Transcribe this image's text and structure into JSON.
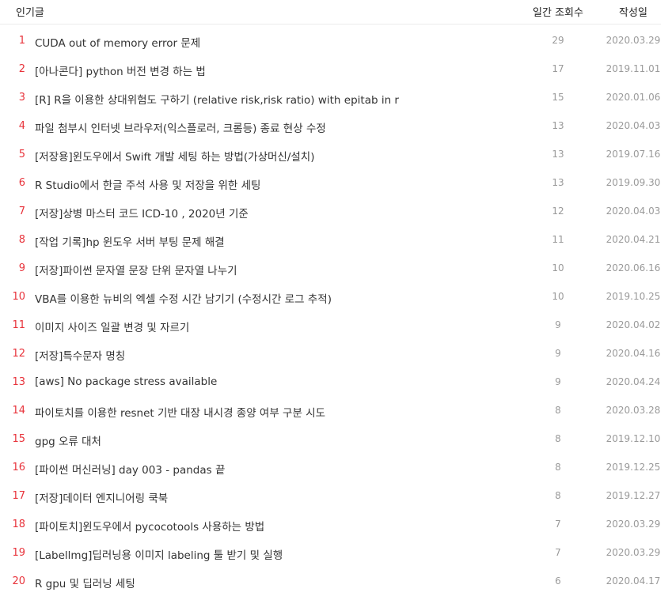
{
  "header": {
    "title": "인기글",
    "views": "일간 조회수",
    "date": "작성일"
  },
  "rows": [
    {
      "rank": "1",
      "title": "CUDA out of memory error 문제",
      "views": "29",
      "date": "2020.03.29"
    },
    {
      "rank": "2",
      "title": "[아나콘다] python 버전 변경 하는 법",
      "views": "17",
      "date": "2019.11.01"
    },
    {
      "rank": "3",
      "title": "[R] R을 이용한 상대위험도 구하기 (relative risk,risk ratio) with epitab in r",
      "views": "15",
      "date": "2020.01.06"
    },
    {
      "rank": "4",
      "title": "파일 첨부시 인터넷 브라우저(익스플로러, 크롬등) 종료 현상 수정",
      "views": "13",
      "date": "2020.04.03"
    },
    {
      "rank": "5",
      "title": "[저장용]윈도우에서 Swift 개발 세팅 하는 방법(가상머신/설치)",
      "views": "13",
      "date": "2019.07.16"
    },
    {
      "rank": "6",
      "title": "R Studio에서 한글 주석 사용 및 저장을 위한 세팅",
      "views": "13",
      "date": "2019.09.30"
    },
    {
      "rank": "7",
      "title": "[저장]상병 마스터 코드 ICD-10 , 2020년 기준",
      "views": "12",
      "date": "2020.04.03"
    },
    {
      "rank": "8",
      "title": "[작업 기록]hp 윈도우 서버 부팅 문제 해결",
      "views": "11",
      "date": "2020.04.21"
    },
    {
      "rank": "9",
      "title": "[저장]파이썬 문자열 문장 단위 문자열 나누기",
      "views": "10",
      "date": "2020.06.16"
    },
    {
      "rank": "10",
      "title": "VBA를 이용한 뉴비의 엑셀 수정 시간 남기기 (수정시간 로그 추적)",
      "views": "10",
      "date": "2019.10.25"
    },
    {
      "rank": "11",
      "title": "이미지 사이즈 일괄 변경 및 자르기",
      "views": "9",
      "date": "2020.04.02"
    },
    {
      "rank": "12",
      "title": "[저장]특수문자 명칭",
      "views": "9",
      "date": "2020.04.16"
    },
    {
      "rank": "13",
      "title": "[aws] No package stress available",
      "views": "9",
      "date": "2020.04.24"
    },
    {
      "rank": "14",
      "title": "파이토치를 이용한 resnet 기반 대장 내시경 종양 여부 구분 시도",
      "views": "8",
      "date": "2020.03.28"
    },
    {
      "rank": "15",
      "title": "gpg 오류 대처",
      "views": "8",
      "date": "2019.12.10"
    },
    {
      "rank": "16",
      "title": "[파이썬 머신러닝] day 003 - pandas 끝",
      "views": "8",
      "date": "2019.12.25"
    },
    {
      "rank": "17",
      "title": "[저장]데이터 엔지니어링 쿡북",
      "views": "8",
      "date": "2019.12.27"
    },
    {
      "rank": "18",
      "title": "[파이토치]윈도우에서 pycocotools 사용하는 방법",
      "views": "7",
      "date": "2020.03.29"
    },
    {
      "rank": "19",
      "title": "[Labellmg]딥러닝용 이미지 labeling 툴 받기 및 실행",
      "views": "7",
      "date": "2020.03.29"
    },
    {
      "rank": "20",
      "title": "R gpu 및 딥러닝 세팅",
      "views": "6",
      "date": "2020.04.17"
    }
  ]
}
